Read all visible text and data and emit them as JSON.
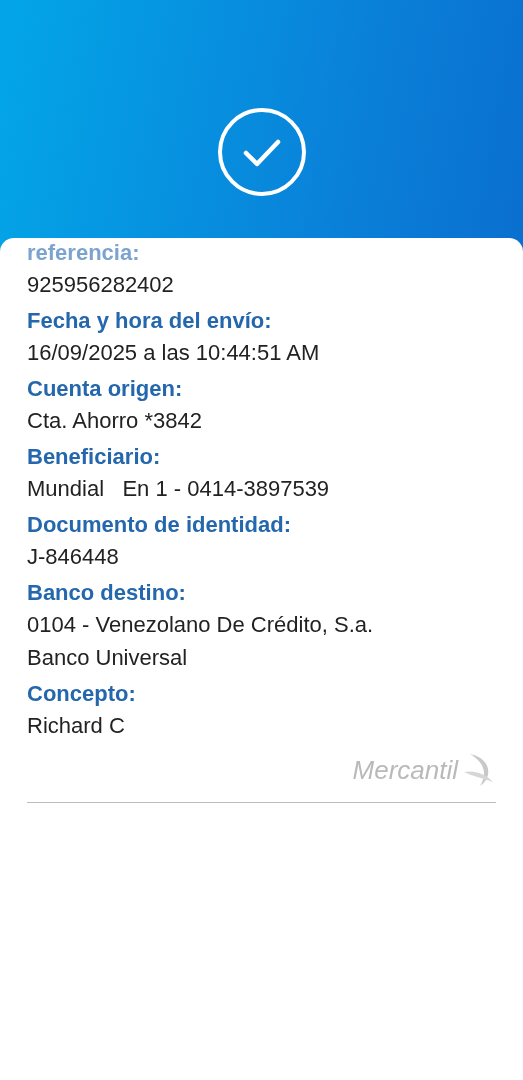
{
  "fields": [
    {
      "label": "referencia:",
      "value": "925956282402"
    },
    {
      "label": "Fecha y hora del envío:",
      "value": "16/09/2025 a las 10:44:51 AM"
    },
    {
      "label": "Cuenta origen:",
      "value": "Cta. Ahorro *3842"
    },
    {
      "label": "Beneficiario:",
      "value": "Mundial   En 1 - 0414-3897539"
    },
    {
      "label": "Documento de identidad:",
      "value": "J-846448"
    },
    {
      "label": "Banco destino:",
      "value": "0104 - Venezolano De Crédito, S.a.\nBanco Universal"
    },
    {
      "label": "Concepto:",
      "value": "Richard C"
    }
  ],
  "brand": "Mercantil"
}
